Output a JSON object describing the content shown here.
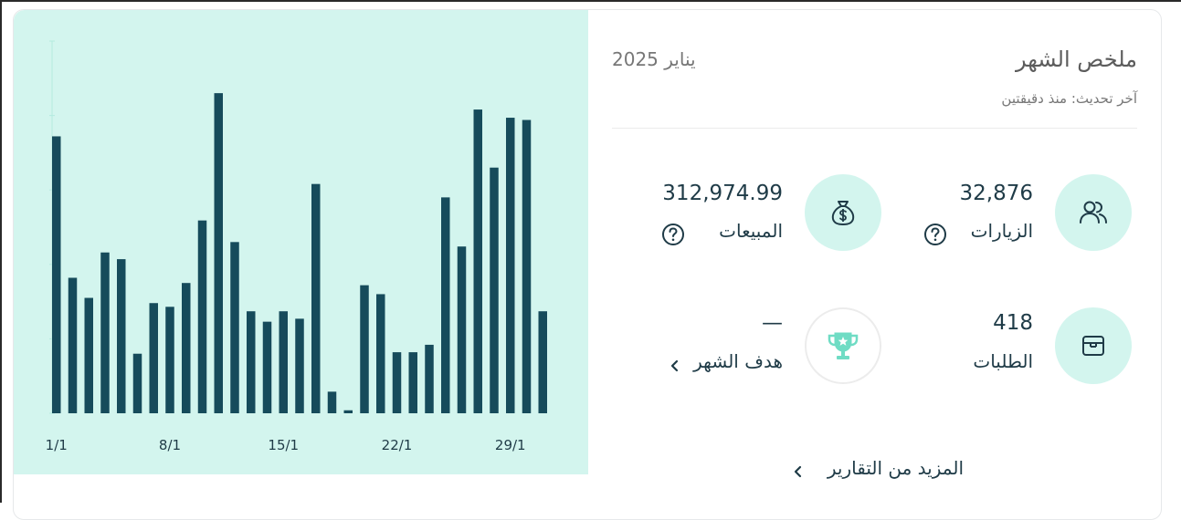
{
  "summary": {
    "title": "ملخص الشهر",
    "period": "يناير 2025",
    "last_updated": "آخر تحديث: منذ دقيقتين"
  },
  "stats": {
    "visits": {
      "value": "32,876",
      "label": "الزيارات",
      "icon": "users-icon"
    },
    "sales": {
      "value": "312,974.99",
      "label": "المبيعات",
      "icon": "money-bag-icon"
    },
    "orders": {
      "value": "418",
      "label": "الطلبات",
      "icon": "box-icon"
    },
    "goal": {
      "value": "—",
      "label": "هدف الشهر",
      "icon": "trophy-icon"
    }
  },
  "more_reports": "المزيد من التقارير",
  "colors": {
    "bar": "#164b5b",
    "panel": "#d3f5ee",
    "accent": "#6fdcc4",
    "text": "#1f3b47"
  },
  "chart_data": {
    "type": "bar",
    "categories": [
      "1/1",
      "2/1",
      "3/1",
      "4/1",
      "5/1",
      "6/1",
      "7/1",
      "8/1",
      "9/1",
      "10/1",
      "11/1",
      "12/1",
      "13/1",
      "14/1",
      "15/1",
      "16/1",
      "17/1",
      "18/1",
      "19/1",
      "20/1",
      "21/1",
      "22/1",
      "23/1",
      "24/1",
      "25/1",
      "26/1",
      "27/1",
      "28/1",
      "29/1",
      "30/1",
      "31/1"
    ],
    "tick_labels": [
      "1/1",
      "8/1",
      "15/1",
      "22/1",
      "29/1"
    ],
    "values": [
      372,
      182,
      155,
      216,
      207,
      80,
      148,
      143,
      175,
      259,
      430,
      230,
      137,
      123,
      137,
      127,
      308,
      29,
      4,
      172,
      160,
      82,
      82,
      92,
      290,
      224,
      408,
      330,
      397,
      394,
      137
    ],
    "ylim": [
      0,
      500
    ],
    "grid": false
  }
}
